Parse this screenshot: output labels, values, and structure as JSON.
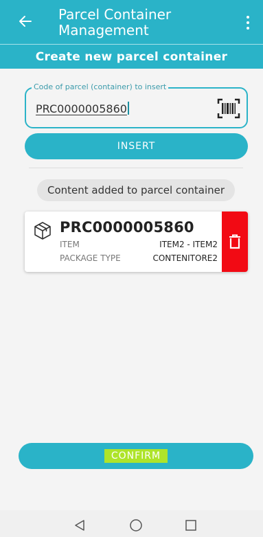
{
  "header": {
    "title": "Parcel Container Management",
    "subtitle": "Create new parcel container"
  },
  "icons": {
    "back": "arrow-left-icon",
    "menu": "more-vertical-icon",
    "barcode": "barcode-scan-icon",
    "package": "package-box-icon",
    "delete": "trash-icon"
  },
  "form": {
    "code_label": "Code of parcel (container) to insert",
    "code_value": "PRC0000005860",
    "insert_label": "INSERT"
  },
  "content": {
    "chip_text": "Content added to parcel container",
    "items": [
      {
        "code": "PRC0000005860",
        "item_key": "ITEM",
        "item_value": "ITEM2 - ITEM2",
        "type_key": "PACKAGE TYPE",
        "type_value": "CONTENITORE2"
      }
    ]
  },
  "footer": {
    "confirm_label": "CONFIRM"
  },
  "colors": {
    "primary": "#2ab3c8",
    "delete": "#f20a14",
    "highlight": "#aee42a"
  }
}
